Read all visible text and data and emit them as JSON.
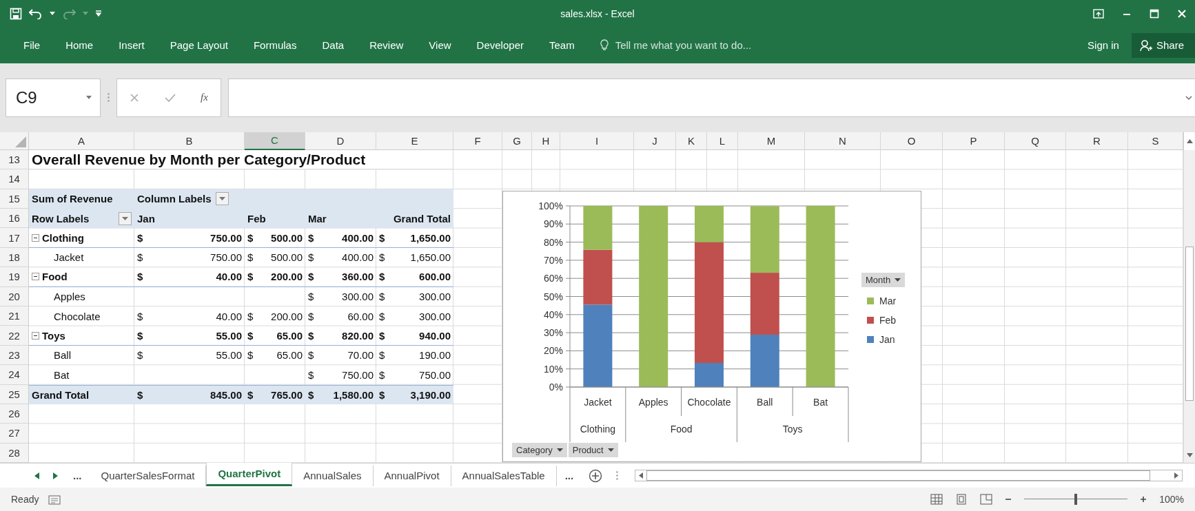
{
  "window": {
    "title": "sales.xlsx - Excel"
  },
  "ribbon": {
    "tabs": [
      {
        "label": "File",
        "selected": false
      },
      {
        "label": "Home",
        "selected": false
      },
      {
        "label": "Insert",
        "selected": false
      },
      {
        "label": "Page Layout",
        "selected": false
      },
      {
        "label": "Formulas",
        "selected": false
      },
      {
        "label": "Data",
        "selected": false
      },
      {
        "label": "Review",
        "selected": false
      },
      {
        "label": "View",
        "selected": false
      },
      {
        "label": "Developer",
        "selected": false
      },
      {
        "label": "Team",
        "selected": false
      }
    ],
    "tell_me": {
      "placeholder": "Tell me what you want to do..."
    },
    "sign_in": "Sign in",
    "share": "Share"
  },
  "formula_bar": {
    "name_box": "C9",
    "function_label": "fx"
  },
  "sheet": {
    "columns": [
      {
        "label": "A",
        "selected": false
      },
      {
        "label": "B",
        "selected": false
      },
      {
        "label": "C",
        "selected": true
      },
      {
        "label": "D",
        "selected": false
      },
      {
        "label": "E",
        "selected": false
      },
      {
        "label": "F",
        "selected": false
      },
      {
        "label": "G",
        "selected": false
      },
      {
        "label": "H",
        "selected": false
      },
      {
        "label": "I",
        "selected": false
      },
      {
        "label": "J",
        "selected": false
      },
      {
        "label": "K",
        "selected": false
      },
      {
        "label": "L",
        "selected": false
      },
      {
        "label": "M",
        "selected": false
      },
      {
        "label": "N",
        "selected": false
      },
      {
        "label": "O",
        "selected": false
      },
      {
        "label": "P",
        "selected": false
      },
      {
        "label": "Q",
        "selected": false
      },
      {
        "label": "R",
        "selected": false
      },
      {
        "label": "S",
        "selected": false
      }
    ],
    "row_numbers": [
      "13",
      "14",
      "15",
      "16",
      "17",
      "18",
      "19",
      "20",
      "21",
      "22",
      "23",
      "24",
      "25",
      "26",
      "27",
      "28"
    ],
    "title": "Overall Revenue by Month per Category/Product",
    "pivot": {
      "value_field": "Sum of Revenue",
      "column_labels": "Column Labels",
      "row_labels": "Row Labels",
      "months": [
        "Jan",
        "Feb",
        "Mar"
      ],
      "total_heading": "Grand Total",
      "groups": [
        {
          "name": "Clothing",
          "expanded": true,
          "values": {
            "jan": {
              "symbol": "$",
              "amount": "750.00"
            },
            "feb": {
              "symbol": "$",
              "amount": "500.00"
            },
            "mar": {
              "symbol": "$",
              "amount": "400.00"
            },
            "total": {
              "symbol": "$",
              "amount": "1,650.00"
            }
          },
          "children": [
            {
              "name": "Jacket",
              "values": {
                "jan": {
                  "symbol": "$",
                  "amount": "750.00"
                },
                "feb": {
                  "symbol": "$",
                  "amount": "500.00"
                },
                "mar": {
                  "symbol": "$",
                  "amount": "400.00"
                },
                "total": {
                  "symbol": "$",
                  "amount": "1,650.00"
                }
              }
            }
          ]
        },
        {
          "name": "Food",
          "expanded": true,
          "values": {
            "jan": {
              "symbol": "$",
              "amount": "40.00"
            },
            "feb": {
              "symbol": "$",
              "amount": "200.00"
            },
            "mar": {
              "symbol": "$",
              "amount": "360.00"
            },
            "total": {
              "symbol": "$",
              "amount": "600.00"
            }
          },
          "children": [
            {
              "name": "Apples",
              "values": {
                "mar": {
                  "symbol": "$",
                  "amount": "300.00"
                },
                "total": {
                  "symbol": "$",
                  "amount": "300.00"
                }
              }
            },
            {
              "name": "Chocolate",
              "values": {
                "jan": {
                  "symbol": "$",
                  "amount": "40.00"
                },
                "feb": {
                  "symbol": "$",
                  "amount": "200.00"
                },
                "mar": {
                  "symbol": "$",
                  "amount": "60.00"
                },
                "total": {
                  "symbol": "$",
                  "amount": "300.00"
                }
              }
            }
          ]
        },
        {
          "name": "Toys",
          "expanded": true,
          "values": {
            "jan": {
              "symbol": "$",
              "amount": "55.00"
            },
            "feb": {
              "symbol": "$",
              "amount": "65.00"
            },
            "mar": {
              "symbol": "$",
              "amount": "820.00"
            },
            "total": {
              "symbol": "$",
              "amount": "940.00"
            }
          },
          "children": [
            {
              "name": "Ball",
              "values": {
                "jan": {
                  "symbol": "$",
                  "amount": "55.00"
                },
                "feb": {
                  "symbol": "$",
                  "amount": "65.00"
                },
                "mar": {
                  "symbol": "$",
                  "amount": "70.00"
                },
                "total": {
                  "symbol": "$",
                  "amount": "190.00"
                }
              }
            },
            {
              "name": "Bat",
              "values": {
                "mar": {
                  "symbol": "$",
                  "amount": "750.00"
                },
                "total": {
                  "symbol": "$",
                  "amount": "750.00"
                }
              }
            }
          ]
        }
      ],
      "grand_total": {
        "label": "Grand Total",
        "values": {
          "jan": {
            "symbol": "$",
            "amount": "845.00"
          },
          "feb": {
            "symbol": "$",
            "amount": "765.00"
          },
          "mar": {
            "symbol": "$",
            "amount": "1,580.00"
          },
          "total": {
            "symbol": "$",
            "amount": "3,190.00"
          }
        }
      }
    }
  },
  "chart": {
    "legend_title": "Month",
    "field_buttons": [
      "Category",
      "Product"
    ],
    "category_groups": [
      "Clothing",
      "Food",
      "Toys"
    ],
    "chart_data": {
      "type": "bar",
      "stacked": true,
      "grid": true,
      "categories": [
        "Jacket",
        "Apples",
        "Chocolate",
        "Ball",
        "Bat"
      ],
      "series": [
        {
          "name": "Jan",
          "color": "#4f81bd",
          "values": [
            45.5,
            0,
            13.3,
            28.9,
            0
          ]
        },
        {
          "name": "Feb",
          "color": "#c0504d",
          "values": [
            30.3,
            0,
            66.7,
            34.2,
            0
          ]
        },
        {
          "name": "Mar",
          "color": "#9bbb59",
          "values": [
            24.2,
            100,
            20,
            36.8,
            100
          ]
        }
      ],
      "ylim": [
        0,
        100
      ],
      "yticks": [
        {
          "value": 0,
          "label": "0%"
        },
        {
          "value": 10,
          "label": "10%"
        },
        {
          "value": 20,
          "label": "20%"
        },
        {
          "value": 30,
          "label": "30%"
        },
        {
          "value": 40,
          "label": "40%"
        },
        {
          "value": 50,
          "label": "50%"
        },
        {
          "value": 60,
          "label": "60%"
        },
        {
          "value": 70,
          "label": "70%"
        },
        {
          "value": 80,
          "label": "80%"
        },
        {
          "value": 90,
          "label": "90%"
        },
        {
          "value": 100,
          "label": "100%"
        }
      ]
    }
  },
  "sheet_tabs": {
    "more_left": "...",
    "tabs": [
      {
        "label": "QuarterSalesFormat",
        "selected": false
      },
      {
        "label": "QuarterPivot",
        "selected": true
      },
      {
        "label": "AnnualSales",
        "selected": false
      },
      {
        "label": "AnnualPivot",
        "selected": false
      },
      {
        "label": "AnnualSalesTable",
        "selected": false
      }
    ],
    "more_right": "..."
  },
  "status_bar": {
    "status": "Ready",
    "zoom": {
      "level": 0.5
    },
    "zoom_label": "100%"
  }
}
